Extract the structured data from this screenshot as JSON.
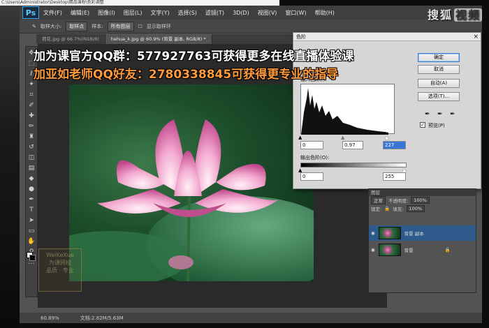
{
  "path_bar": "C:\\Users\\Administrator\\Desktop\\精品课程\\色彩调整",
  "app": {
    "logo": "Ps"
  },
  "menu": [
    "文件(F)",
    "编辑(E)",
    "图像(I)",
    "图层(L)",
    "文字(Y)",
    "选择(S)",
    "滤镜(T)",
    "3D(D)",
    "视图(V)",
    "窗口(W)",
    "帮助(H)"
  ],
  "options": {
    "sample_size_label": "取样大小:",
    "sample_size_value": "取样点",
    "sample_label": "样本:",
    "sample_value": "所有图层",
    "show_ring": "显示取样环"
  },
  "tabs": [
    {
      "label": "荷花.jpg @ 66.7%(RGB/8)"
    },
    {
      "label": "hehua_k.jpg @ 60.9% (背景 副本, RGB/8) *"
    }
  ],
  "watermark": {
    "text": "搜狐",
    "badge": "视频"
  },
  "ads": {
    "line1": "加为课官方QQ群：577927763可获得更多在线直播体验课",
    "line2": "加亚如老师QQ好友：2780338845可获得更专业的指导"
  },
  "school_logo": {
    "line1": "WeiKeXue",
    "line2": "为课网校",
    "line3": "品质 · 专业"
  },
  "levels": {
    "title": "色阶",
    "input_label": "输入色阶(I):",
    "output_label": "输出色阶(O):",
    "input_black": "0",
    "input_gamma": "0.97",
    "input_white": "227",
    "output_black": "0",
    "output_white": "255",
    "ok": "确定",
    "cancel": "取消",
    "auto": "自动(A)",
    "options": "选项(T)...",
    "preview": "预览(P)",
    "close": "×"
  },
  "layers_panel": {
    "title": "图层",
    "blend": "正常",
    "opacity_label": "不透明度:",
    "opacity": "100%",
    "lock_label": "锁定:",
    "fill_label": "填充:",
    "fill": "100%",
    "layers": [
      {
        "name": "背景 副本",
        "selected": true
      },
      {
        "name": "背景",
        "selected": false
      }
    ]
  },
  "status": {
    "zoom": "60.89%",
    "doc": "文档:2.82M/5.63M"
  }
}
